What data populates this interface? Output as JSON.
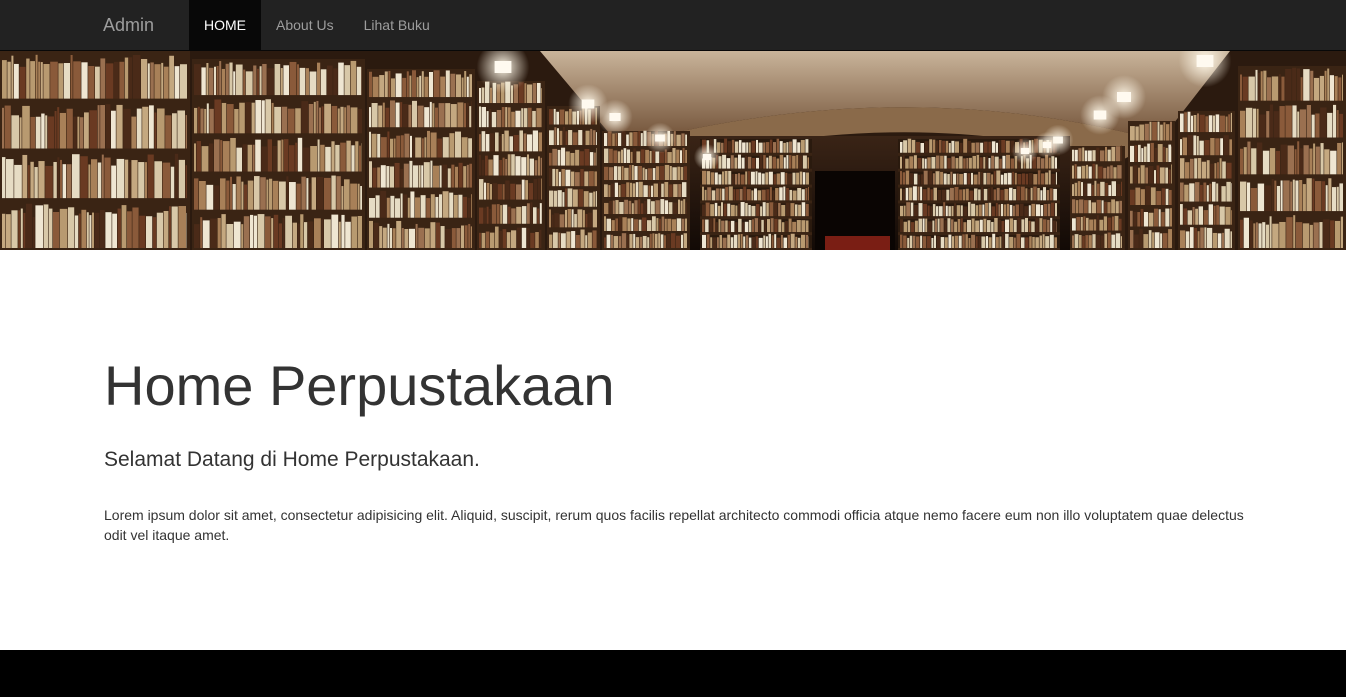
{
  "navbar": {
    "brand": "Admin",
    "items": [
      {
        "label": "HOME",
        "active": true
      },
      {
        "label": "About Us",
        "active": false
      },
      {
        "label": "Lihat Buku",
        "active": false
      }
    ]
  },
  "hero": {
    "icon": "library-banner-image"
  },
  "main": {
    "title": "Home Perpustakaan",
    "lead": "Selamat Datang di Home Perpustakaan.",
    "body": "Lorem ipsum dolor sit amet, consectetur adipisicing elit. Aliquid, suscipit, rerum quos facilis repellat architecto commodi officia atque nemo facere eum non illo voluptatem quae delectus odit vel itaque amet."
  },
  "colors": {
    "navbar_bg": "#222222",
    "nav_active_bg": "#080808",
    "nav_text": "#9d9d9d",
    "nav_active_text": "#ffffff",
    "text": "#333333",
    "footer_bg": "#000000"
  }
}
